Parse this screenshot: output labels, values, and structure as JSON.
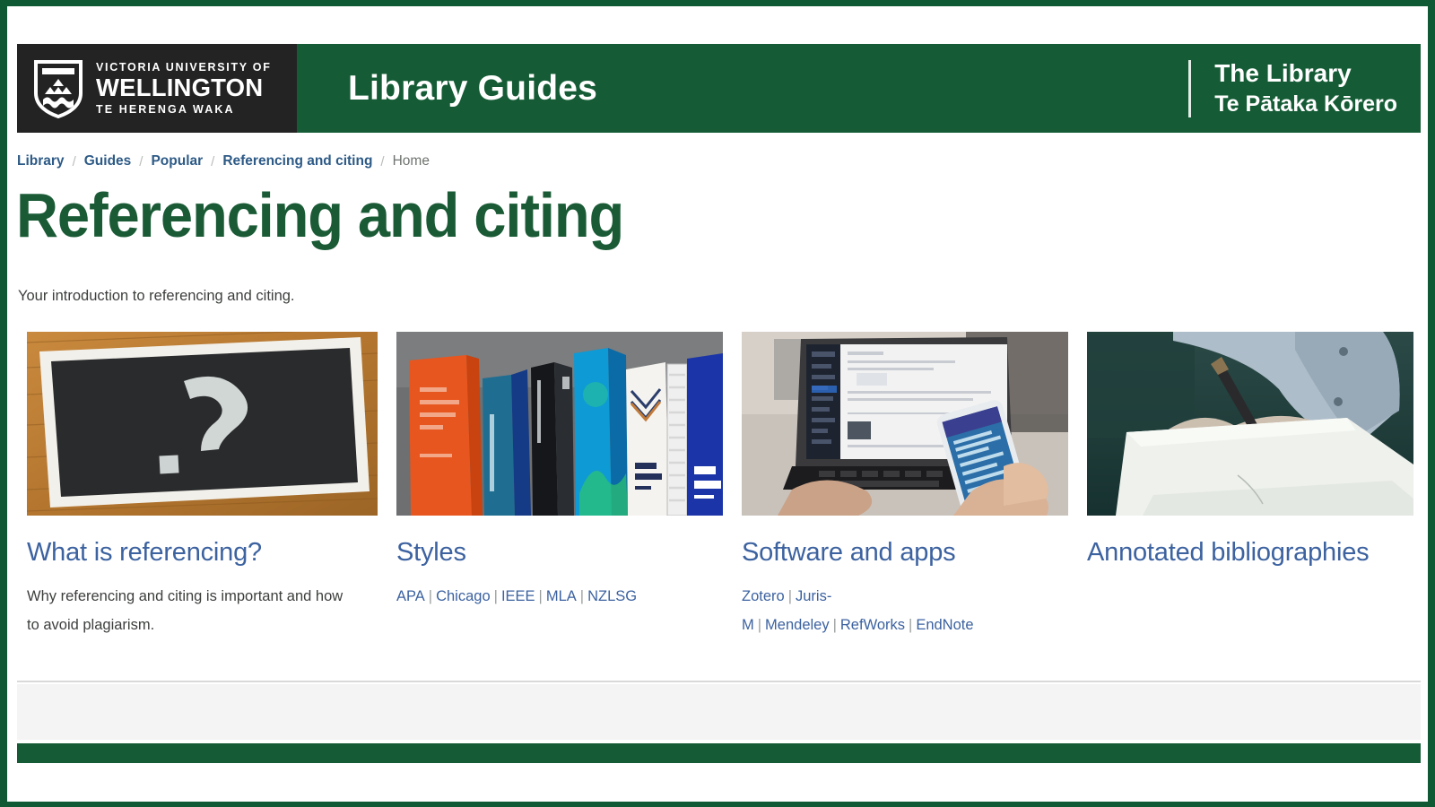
{
  "brand": {
    "logo_line1": "VICTORIA UNIVERSITY OF",
    "logo_line2": "WELLINGTON",
    "logo_line3": "TE HERENGA WAKA",
    "logo_icon": "shield-crest-icon",
    "header_title": "Library Guides",
    "right_line1": "The Library",
    "right_line2": "Te Pātaka Kōrero",
    "header_green": "#155c36",
    "logo_block_dark": "#232323",
    "link_blue": "#3c62a0",
    "heading_green": "#1a5b36"
  },
  "breadcrumb": {
    "items": [
      {
        "label": "Library",
        "current": false
      },
      {
        "label": "Guides",
        "current": false
      },
      {
        "label": "Popular",
        "current": false
      },
      {
        "label": "Referencing and citing",
        "current": false
      },
      {
        "label": "Home",
        "current": true
      }
    ],
    "separator": "/"
  },
  "page": {
    "title": "Referencing and citing",
    "intro": "Your introduction to referencing and citing."
  },
  "cards": [
    {
      "title": "What is referencing?",
      "image_alt": "chalkboard-question-mark-image",
      "body": "Why referencing and citing is important and how to avoid plagiarism.",
      "links": []
    },
    {
      "title": "Styles",
      "image_alt": "style-manual-books-image",
      "body": "",
      "links": [
        "APA",
        "Chicago",
        "IEEE",
        "MLA",
        "NZLSG"
      ]
    },
    {
      "title": "Software and apps",
      "image_alt": "laptop-and-phone-image",
      "body": "",
      "links": [
        "Zotero",
        "Juris-M",
        "Mendeley",
        "RefWorks",
        "EndNote"
      ]
    },
    {
      "title": "Annotated bibliographies",
      "image_alt": "person-writing-on-paper-image",
      "body": "",
      "links": []
    }
  ],
  "link_separator": "|"
}
